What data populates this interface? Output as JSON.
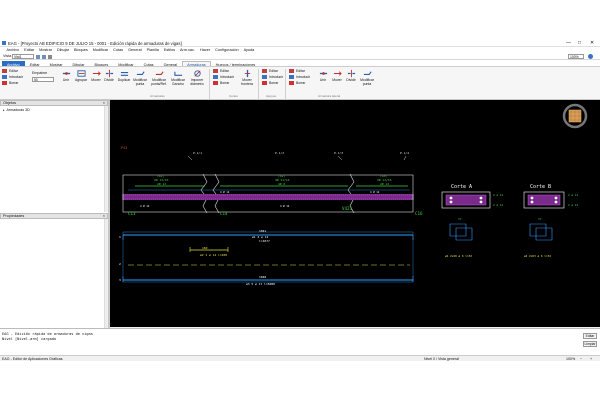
{
  "window": {
    "title": "EAG - [Proyecto AB EDIFICIO 9 DE JULIO 15 - 0001 - Edición rápida de armaduras de vigas]",
    "controls": [
      "—",
      "□",
      "✕"
    ]
  },
  "menu": [
    "Archivo",
    "Editar",
    "Mostrar",
    "Dibujar",
    "Bloques",
    "Modificar",
    "Cotas",
    "General",
    "Planilla",
    "Estilos",
    "Arm.vac.",
    "Hacer",
    "Configuración",
    "Ayuda"
  ],
  "viewrow": {
    "label": "Vista",
    "value": "Vist1",
    "zoom": "100%"
  },
  "tabs": [
    {
      "label": "Archivo",
      "kind": "file"
    },
    {
      "label": "Editar"
    },
    {
      "label": "Mostrar"
    },
    {
      "label": "Dibujar"
    },
    {
      "label": "Bloques"
    },
    {
      "label": "Modificar"
    },
    {
      "label": "Cotas"
    },
    {
      "label": "General"
    },
    {
      "label": "Armaduras",
      "kind": "active"
    },
    {
      "label": "Huecos / terminaciones"
    }
  ],
  "ribbon": {
    "small": {
      "editar": "Editar",
      "introducir": "Introducir",
      "borrar": "Borrar"
    },
    "empalme": {
      "label": "Empalme",
      "value": "50"
    },
    "buttons": [
      "Unir",
      "Agrupar",
      "Mover",
      "Dividir",
      "Duplicar",
      "Modificar punta",
      "Modificar punta/Ref.",
      "Modificar Gancho",
      "Imponer diámetro"
    ],
    "g2": {
      "editar": "Editar",
      "introducir": "Introducir",
      "borrar": "Borrar",
      "btn": "Mover frontera"
    },
    "g3": {
      "editar": "Editar",
      "introducir": "Introducir",
      "borrar": "Borrar"
    },
    "g4": {
      "editar": "Editar",
      "introducir": "Introducir",
      "borrar": "Borrar",
      "buttons": [
        "Unir",
        "Mover",
        "Dividir",
        "Modificar punta"
      ]
    },
    "groups": [
      "Armaduras",
      "Cortes",
      "Apoyos",
      "Armadura lateral"
    ]
  },
  "left": {
    "objects_title": "Objetos",
    "tree_item": "Armaduras 3D",
    "props_title": "Propiedades"
  },
  "drawing": {
    "marker": "P43",
    "top_labels": [
      "P.1/1",
      "P.1/2",
      "P.1/3",
      "P.1/4"
    ],
    "bar_labels_top": [
      {
        "a": "(A1)",
        "b": "2Ø 12/16",
        "c": "2Ø 12"
      },
      {
        "a": "(A2)",
        "b": "4Ø 12/16",
        "c": "4Ø 8"
      },
      {
        "a": "(A3)",
        "b": "2Ø 12/16",
        "c": "2Ø 12"
      }
    ],
    "small_labels": [
      "4 Ø 12",
      "4 Ø 12",
      "4 Ø 12",
      "4 Ø 12"
    ],
    "columns": [
      "C13",
      "C14",
      "V421",
      "C16"
    ],
    "lower": {
      "dim1": "1041",
      "txt1": "ø1 4 ø 12",
      "txt1b": "l=1077",
      "dim2": "160",
      "txt2": "ø2 1 ø 12 l=200",
      "dim3": "1040",
      "txt3": "ø3 5 ø 17 l=5080",
      "marks": [
        "1",
        "2",
        "3"
      ]
    },
    "cortes": [
      {
        "title": "Corte A",
        "lbl1": "2 ø 12",
        "lbl2": "2 ø 12",
        "sz": "17",
        "foot": "ø4 2x20 ø 6 l=32"
      },
      {
        "title": "Corte B",
        "lbl1": "2 ø 12",
        "lbl2": "2 ø 12",
        "sz": "17",
        "foot": "ø4 2x63 ø 6 l=32"
      }
    ]
  },
  "console": {
    "line1": "EAG - Edición rápida de armaduras de vigas",
    "line2": "Nivel [Nivel-arm] cargado",
    "btn_edit": "Editar",
    "btn_clear": "Limpiar"
  },
  "status": {
    "left": "EAG - Editor de Aplicaciones Gráficas",
    "right": "Nivel 0 / Vista general",
    "zoom": "100%"
  }
}
